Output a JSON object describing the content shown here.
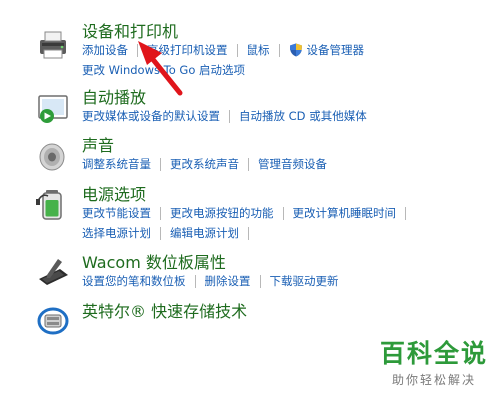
{
  "categories": [
    {
      "title": "设备和打印机",
      "icon": "printer-icon",
      "lines": [
        [
          "添加设备",
          "高级打印机设置",
          "鼠标",
          "设备管理器"
        ],
        [
          "更改 Windows To Go 启动选项"
        ]
      ]
    },
    {
      "title": "自动播放",
      "icon": "autoplay-icon",
      "lines": [
        [
          "更改媒体或设备的默认设置",
          "自动播放 CD 或其他媒体"
        ]
      ]
    },
    {
      "title": "声音",
      "icon": "speaker-icon",
      "lines": [
        [
          "调整系统音量",
          "更改系统声音",
          "管理音频设备"
        ]
      ]
    },
    {
      "title": "电源选项",
      "icon": "battery-icon",
      "lines": [
        [
          "更改节能设置",
          "更改电源按钮的功能",
          "更改计算机睡眠时间"
        ],
        [
          "选择电源计划",
          "编辑电源计划"
        ]
      ]
    },
    {
      "title": "Wacom 数位板属性",
      "icon": "pen-tablet-icon",
      "lines": [
        [
          "设置您的笔和数位板",
          "删除设置",
          "下载驱动更新"
        ]
      ]
    },
    {
      "title": "英特尔® 快速存储技术",
      "icon": "storage-icon",
      "lines": []
    }
  ],
  "watermark": {
    "main": "百科全说",
    "sub": "助你轻松解决"
  },
  "colors": {
    "title": "#1e6b1e",
    "link": "#1a5fb4",
    "arrow": "#e0151b",
    "watermark": "#2d9a3a"
  }
}
